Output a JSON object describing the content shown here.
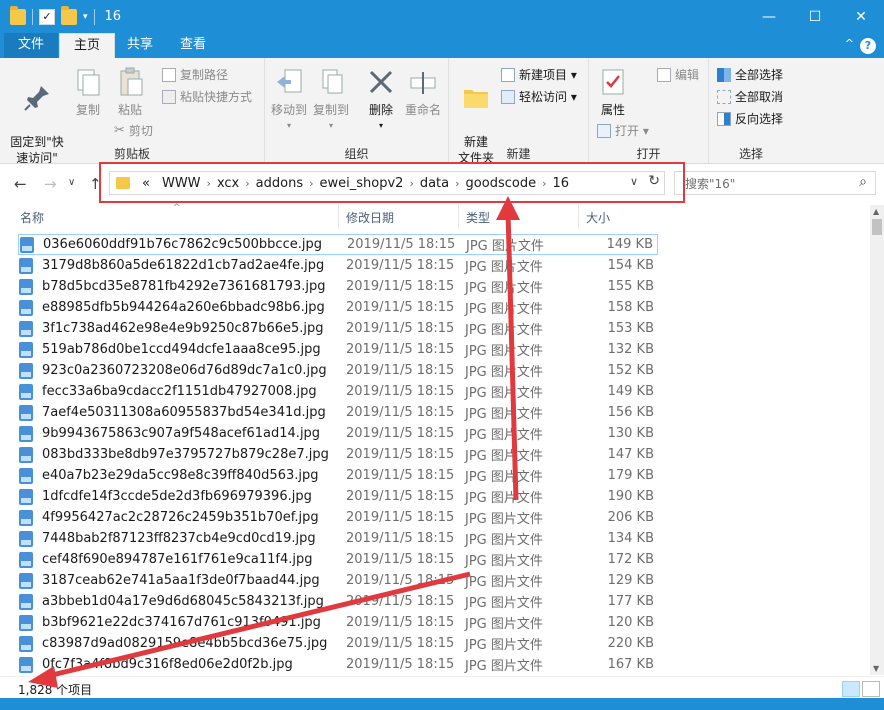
{
  "window": {
    "title": "16",
    "minimize": "—",
    "maximize": "☐",
    "close": "✕"
  },
  "tabs": {
    "file": "文件",
    "home": "主页",
    "share": "共享",
    "view": "查看",
    "collapse": "^",
    "help": "?"
  },
  "ribbon": {
    "clipboard": {
      "label": "剪贴板",
      "pin": "固定到\"快\n速访问\"",
      "copy": "复制",
      "paste": "粘贴",
      "copy_path": "复制路径",
      "paste_shortcut": "粘贴快捷方式",
      "cut": "剪切"
    },
    "organize": {
      "label": "组织",
      "move_to": "移动到",
      "copy_to": "复制到",
      "delete": "删除",
      "rename": "重命名"
    },
    "new": {
      "label": "新建",
      "new_folder": "新建\n文件夹",
      "new_item": "新建项目 ▾",
      "easy_access": "轻松访问 ▾"
    },
    "open": {
      "label": "打开",
      "properties": "属性",
      "open": "打开 ▾",
      "edit": "编辑"
    },
    "select": {
      "label": "选择",
      "select_all": "全部选择",
      "select_none": "全部取消",
      "invert": "反向选择"
    }
  },
  "nav": {
    "back": "←",
    "forward": "→",
    "dropdown": "∨",
    "up": "↑",
    "crumbs": [
      "«",
      "WWW",
      "xcx",
      "addons",
      "ewei_shopv2",
      "data",
      "goodscode",
      "16"
    ],
    "addr_dropdown": "∨",
    "refresh": "↻",
    "search_placeholder": "搜索\"16\"",
    "search_icon": "⌕"
  },
  "columns": {
    "name": "名称",
    "date": "修改日期",
    "type": "类型",
    "size": "大小",
    "sort_indicator": "^"
  },
  "files": [
    {
      "name": "036e6060ddf91b76c7862c9c500bbcce.jpg",
      "date": "2019/11/5 18:15",
      "type": "JPG 图片文件",
      "size": "149 KB"
    },
    {
      "name": "3179d8b860a5de61822d1cb7ad2ae4fe.jpg",
      "date": "2019/11/5 18:15",
      "type": "JPG 图片文件",
      "size": "154 KB"
    },
    {
      "name": "b78d5bcd35e8781fb4292e7361681793.jpg",
      "date": "2019/11/5 18:15",
      "type": "JPG 图片文件",
      "size": "155 KB"
    },
    {
      "name": "e88985dfb5b944264a260e6bbadc98b6.jpg",
      "date": "2019/11/5 18:15",
      "type": "JPG 图片文件",
      "size": "158 KB"
    },
    {
      "name": "3f1c738ad462e98e4e9b9250c87b66e5.jpg",
      "date": "2019/11/5 18:15",
      "type": "JPG 图片文件",
      "size": "153 KB"
    },
    {
      "name": "519ab786d0be1ccd494dcfe1aaa8ce95.jpg",
      "date": "2019/11/5 18:15",
      "type": "JPG 图片文件",
      "size": "132 KB"
    },
    {
      "name": "923c0a2360723208e06d76d89dc7a1c0.jpg",
      "date": "2019/11/5 18:15",
      "type": "JPG 图片文件",
      "size": "152 KB"
    },
    {
      "name": "fecc33a6ba9cdacc2f1151db47927008.jpg",
      "date": "2019/11/5 18:15",
      "type": "JPG 图片文件",
      "size": "149 KB"
    },
    {
      "name": "7aef4e50311308a60955837bd54e341d.jpg",
      "date": "2019/11/5 18:15",
      "type": "JPG 图片文件",
      "size": "156 KB"
    },
    {
      "name": "9b9943675863c907a9f548acef61ad14.jpg",
      "date": "2019/11/5 18:15",
      "type": "JPG 图片文件",
      "size": "130 KB"
    },
    {
      "name": "083bd333be8db97e3795727b879c28e7.jpg",
      "date": "2019/11/5 18:15",
      "type": "JPG 图片文件",
      "size": "147 KB"
    },
    {
      "name": "e40a7b23e29da5cc98e8c39ff840d563.jpg",
      "date": "2019/11/5 18:15",
      "type": "JPG 图片文件",
      "size": "179 KB"
    },
    {
      "name": "1dfcdfe14f3ccde5de2d3fb696979396.jpg",
      "date": "2019/11/5 18:15",
      "type": "JPG 图片文件",
      "size": "190 KB"
    },
    {
      "name": "4f9956427ac2c28726c2459b351b70ef.jpg",
      "date": "2019/11/5 18:15",
      "type": "JPG 图片文件",
      "size": "206 KB"
    },
    {
      "name": "7448bab2f87123ff8237cb4e9cd0cd19.jpg",
      "date": "2019/11/5 18:15",
      "type": "JPG 图片文件",
      "size": "134 KB"
    },
    {
      "name": "cef48f690e894787e161f761e9ca11f4.jpg",
      "date": "2019/11/5 18:15",
      "type": "JPG 图片文件",
      "size": "172 KB"
    },
    {
      "name": "3187ceab62e741a5aa1f3de0f7baad44.jpg",
      "date": "2019/11/5 18:15",
      "type": "JPG 图片文件",
      "size": "129 KB"
    },
    {
      "name": "a3bbeb1d04a17e9d6d68045c5843213f.jpg",
      "date": "2019/11/5 18:15",
      "type": "JPG 图片文件",
      "size": "177 KB"
    },
    {
      "name": "b3bf9621e22dc374167d761c913f0491.jpg",
      "date": "2019/11/5 18:15",
      "type": "JPG 图片文件",
      "size": "120 KB"
    },
    {
      "name": "c83987d9ad0829159e8e4bb5bcd36e75.jpg",
      "date": "2019/11/5 18:15",
      "type": "JPG 图片文件",
      "size": "220 KB"
    },
    {
      "name": "0fc7f3a4f8bd9c316f8ed06e2d0f2b.jpg",
      "date": "2019/11/5 18:15",
      "type": "JPG 图片文件",
      "size": "167 KB"
    }
  ],
  "status": {
    "count": "1,828 个项目"
  },
  "colors": {
    "accent": "#1e8fd6",
    "annotation": "#e0393e"
  }
}
